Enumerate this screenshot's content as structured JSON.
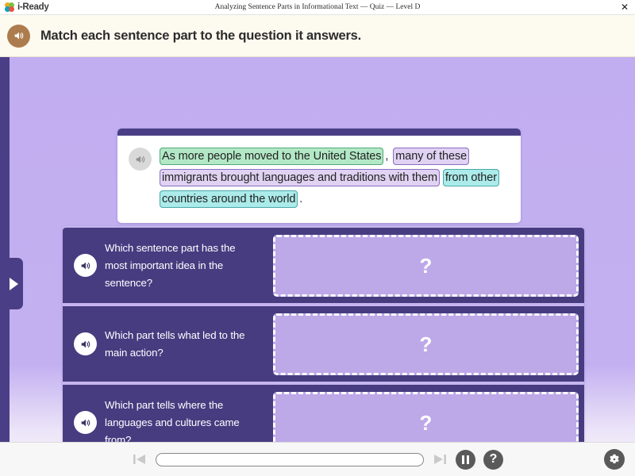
{
  "titlebar": {
    "brand": "i-Ready",
    "title": "Analyzing Sentence Parts in Informational Text — Quiz — Level D",
    "close_label": "✕"
  },
  "instruction": {
    "text": "Match each sentence part to the question it answers.",
    "speaker_icon": "speaker-icon",
    "accent_color": "#ad7c4e"
  },
  "sentence_card": {
    "speaker_icon": "speaker-icon",
    "segments": [
      {
        "text": "As more people moved to the United States",
        "style": "green",
        "color": "#b3e8c6"
      },
      {
        "text": ",",
        "style": "plain",
        "color": "transparent"
      },
      {
        "text": "many of these immigrants brought languages and traditions with them",
        "style": "purple",
        "color": "#e0d2f2"
      },
      {
        "text": " ",
        "style": "plain",
        "color": "transparent"
      },
      {
        "text": "from other countries around the world",
        "style": "cyan",
        "color": "#abebea"
      },
      {
        "text": ".",
        "style": "plain",
        "color": "transparent"
      }
    ]
  },
  "match_rows": [
    {
      "question": "Which sentence part has the most important idea in the sentence?",
      "speaker_icon": "speaker-icon",
      "dropzone_placeholder": "?"
    },
    {
      "question": "Which part tells what led to the main action?",
      "speaker_icon": "speaker-icon",
      "dropzone_placeholder": "?"
    },
    {
      "question": "Which part tells where the languages and cultures came from?",
      "speaker_icon": "speaker-icon",
      "dropzone_placeholder": "?"
    }
  ],
  "side_tab": {
    "icon": "chevron-right-icon"
  },
  "toolbar": {
    "prev_icon": "skip-previous-icon",
    "next_icon": "skip-next-icon",
    "pause_icon": "pause-icon",
    "help_label": "?",
    "settings_icon": "gear-icon",
    "progress_percent": 0
  },
  "colors": {
    "panel_purple": "#473c80",
    "stage_lavender": "#c1aef0",
    "dropzone_fill": "#bda8e8",
    "banner_cream": "#fdfaf0"
  }
}
